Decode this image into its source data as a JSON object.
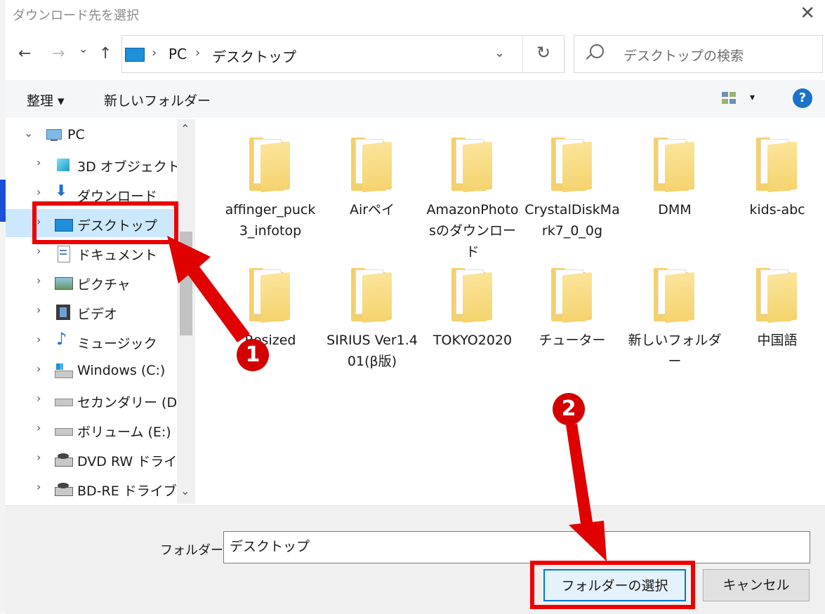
{
  "window": {
    "title": "ダウンロード先を選択",
    "close": "✕"
  },
  "nav": {
    "back": "←",
    "forward": "→",
    "recent": "⌄",
    "up": "↑",
    "refresh": "↻",
    "dropdown": "⌄"
  },
  "address": {
    "separator": "›",
    "crumbs": [
      "PC",
      "デスクトップ"
    ]
  },
  "search": {
    "placeholder": "デスクトップの検索"
  },
  "toolbar": {
    "organize": "整理 ▾",
    "new_folder": "新しいフォルダー",
    "view_menu": "▾",
    "help": "?"
  },
  "tree": {
    "expand_open": "⌄",
    "expand_closed": "›",
    "items": [
      {
        "label": "PC"
      },
      {
        "label": "3D オブジェクト"
      },
      {
        "label": "ダウンロード"
      },
      {
        "label": "デスクトップ"
      },
      {
        "label": "ドキュメント"
      },
      {
        "label": "ピクチャ"
      },
      {
        "label": "ビデオ"
      },
      {
        "label": "ミュージック"
      },
      {
        "label": "Windows (C:)"
      },
      {
        "label": "セカンダリー (D:)"
      },
      {
        "label": "ボリューム (E:)"
      },
      {
        "label": "DVD RW ドライブ"
      },
      {
        "label": "BD-RE ドライブ ("
      }
    ],
    "scroll_up": "⌃",
    "scroll_down": "⌄"
  },
  "files": [
    {
      "name": "affinger_puck3_infotop",
      "kind": "pdf"
    },
    {
      "name": "Airペイ",
      "kind": "pdf"
    },
    {
      "name": "AmazonPhotosのダウンロード",
      "kind": "doc"
    },
    {
      "name": "CrystalDiskMark7_0_0g",
      "kind": "plain"
    },
    {
      "name": "DMM",
      "kind": "image"
    },
    {
      "name": "kids-abc",
      "kind": "abc"
    },
    {
      "name": "Resized",
      "kind": "plain"
    },
    {
      "name": "SIRIUS Ver1.401(β版)",
      "kind": "pdf"
    },
    {
      "name": "TOKYO2020",
      "kind": "pdf"
    },
    {
      "name": "チューター",
      "kind": "plain"
    },
    {
      "name": "新しいフォルダー",
      "kind": "sheet"
    },
    {
      "name": "中国語",
      "kind": "pdf"
    }
  ],
  "footer": {
    "folder_label": "フォルダー:",
    "folder_value": "デスクトップ",
    "select_button": "フォルダーの選択",
    "cancel_button": "キャンセル"
  },
  "annotations": {
    "step1": "1",
    "step2": "2",
    "color": "#e00000"
  }
}
